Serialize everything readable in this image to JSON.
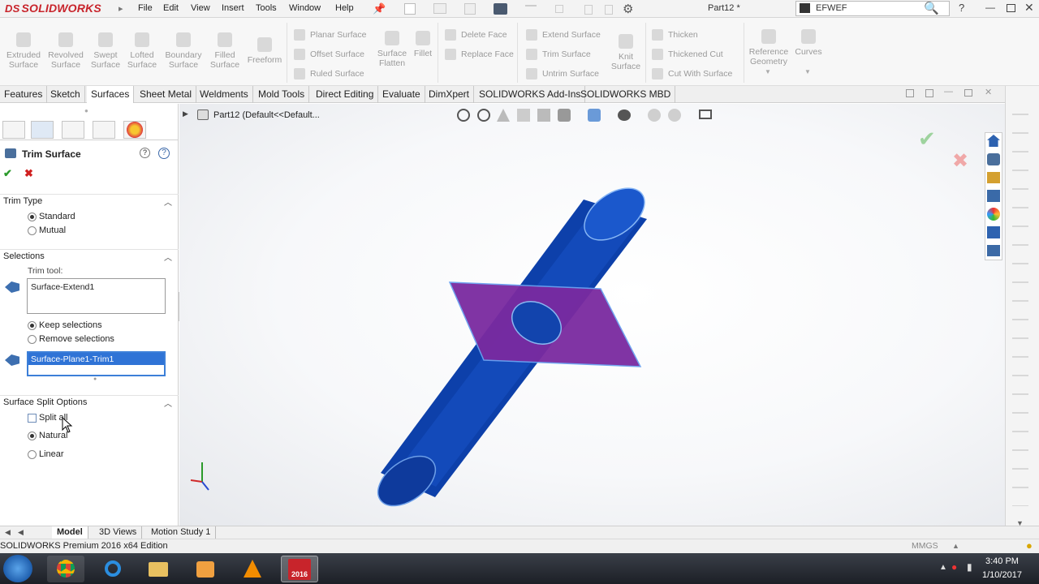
{
  "app": {
    "logo_text": "SOLIDWORKS",
    "logo_mark": "DS",
    "menu": [
      "File",
      "Edit",
      "View",
      "Insert",
      "Tools",
      "Window",
      "Help"
    ],
    "doc_title": "Part12 *",
    "search_value": "EFWEF",
    "help_glyph": "?"
  },
  "ribbon": {
    "big": [
      {
        "label": "Extruded\nSurface"
      },
      {
        "label": "Revolved\nSurface"
      },
      {
        "label": "Swept\nSurface"
      },
      {
        "label": "Lofted\nSurface"
      },
      {
        "label": "Boundary\nSurface"
      },
      {
        "label": "Filled\nSurface"
      },
      {
        "label": "Freeform"
      }
    ],
    "col1": [
      "Planar Surface",
      "Offset Surface",
      "Ruled Surface"
    ],
    "col1b": [
      {
        "label": "Surface\nFlatten"
      },
      {
        "label": "Fillet"
      }
    ],
    "col2": [
      "Delete Face",
      "Replace Face"
    ],
    "col3": [
      "Extend Surface",
      "Trim Surface",
      "Untrim Surface"
    ],
    "knit": {
      "label": "Knit\nSurface"
    },
    "col4": [
      "Thicken",
      "Thickened Cut",
      "Cut With Surface"
    ],
    "ref": {
      "label": "Reference\nGeometry"
    },
    "curves": {
      "label": "Curves"
    }
  },
  "tabs": [
    "Features",
    "Sketch",
    "Surfaces",
    "Sheet Metal",
    "Weldments",
    "Mold Tools",
    "Direct Editing",
    "Evaluate",
    "DimXpert",
    "SOLIDWORKS Add-Ins",
    "SOLIDWORKS MBD"
  ],
  "active_tab": "Surfaces",
  "feature_tree_path": "Part12  (Default<<Default...",
  "property_manager": {
    "title": "Trim Surface",
    "trim_type": {
      "heading": "Trim Type",
      "options": [
        "Standard",
        "Mutual"
      ],
      "selected": "Standard"
    },
    "selections": {
      "heading": "Selections",
      "trim_tool_label": "Trim tool:",
      "trim_tool_value": "Surface-Extend1",
      "keep_options": [
        "Keep selections",
        "Remove selections"
      ],
      "selected": "Keep selections",
      "pieces_value": "Surface-Plane1-Trim1"
    },
    "split_options": {
      "heading": "Surface Split Options",
      "split_all_label": "Split all",
      "split_all_checked": false,
      "options": [
        "Natural",
        "Linear"
      ],
      "selected": "Natural"
    }
  },
  "bottom_tabs": [
    "Model",
    "3D Views",
    "Motion Study 1"
  ],
  "active_bottom_tab": "Model",
  "status": {
    "left": "SOLIDWORKS Premium 2016 x64 Edition",
    "units": "MMGS"
  },
  "taskbar": {
    "time": "3:40 PM",
    "date": "1/10/2017",
    "sw_badge": "2016"
  },
  "colors": {
    "cylinder": "#0a3fa8",
    "plane": "#7a2aa0",
    "accent": "#2f6fd0"
  }
}
